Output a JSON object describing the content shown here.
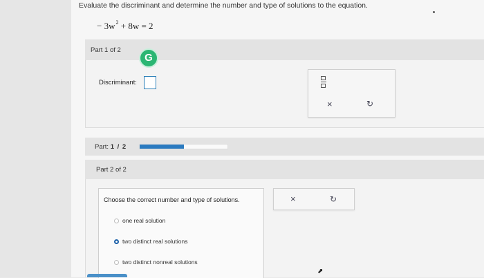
{
  "question": {
    "prompt": "Evaluate the discriminant and determine the number and type of solutions to the equation.",
    "equation_pre": "− 3w",
    "equation_exp": "2",
    "equation_post": " + 8w = 2"
  },
  "part1": {
    "label": "Part 1 of 2",
    "badge_letter": "G",
    "discriminant_label": "Discriminant:",
    "discriminant_value": "",
    "tools": {
      "fraction_icon": "fraction-icon",
      "clear_label": "×",
      "undo_label": "↻"
    }
  },
  "progress": {
    "label_prefix": "Part:",
    "label_value": "1 / 2",
    "fraction": 0.5,
    "fill_color": "#2a7ac0"
  },
  "part2": {
    "label": "Part 2 of 2",
    "choice_prompt": "Choose the correct number and type of solutions.",
    "options": [
      {
        "label": "one real solution",
        "selected": false
      },
      {
        "label": "two distinct real solutions",
        "selected": true
      },
      {
        "label": "two distinct nonreal solutions",
        "selected": false
      }
    ],
    "tools": {
      "clear_label": "×",
      "undo_label": "↻"
    }
  },
  "colors": {
    "accent": "#2a7ac0",
    "badge": "#2bb673"
  }
}
